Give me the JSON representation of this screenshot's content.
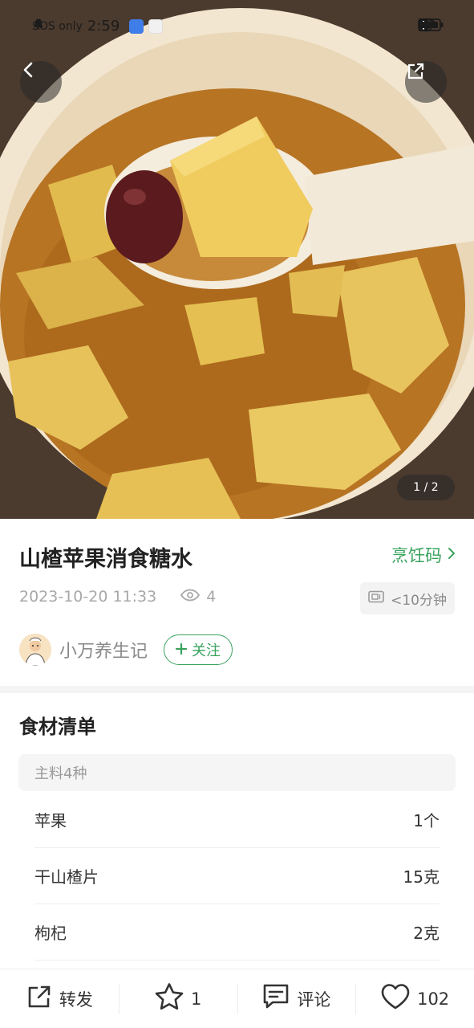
{
  "status_bar": {
    "carrier": "SOS only",
    "time": "2:59"
  },
  "hero": {
    "page_indicator": "1 / 2"
  },
  "recipe": {
    "title": "山楂苹果消食糖水",
    "cook_code_label": "烹饪码",
    "date": "2023-10-20 11:33",
    "views": "4",
    "duration": "<10分钟"
  },
  "author": {
    "name": "小万养生记",
    "follow_label": "关注"
  },
  "ingredients_section": {
    "title": "食材清单",
    "group_label": "主料4种",
    "items": [
      {
        "name": "苹果",
        "amount": "1个"
      },
      {
        "name": "干山楂片",
        "amount": "15克"
      },
      {
        "name": "枸杞",
        "amount": "2克"
      }
    ]
  },
  "bottom_bar": {
    "forward_label": "转发",
    "star_count": "1",
    "comment_label": "评论",
    "like_count": "102"
  },
  "colors": {
    "accent_green": "#3aa35f"
  },
  "icons": {
    "back": "chevron-left-icon",
    "share": "share-icon",
    "eye": "eye-icon",
    "timer": "timer-icon",
    "forward": "forward-icon",
    "star": "star-icon",
    "comment": "comment-icon",
    "heart": "heart-icon"
  }
}
